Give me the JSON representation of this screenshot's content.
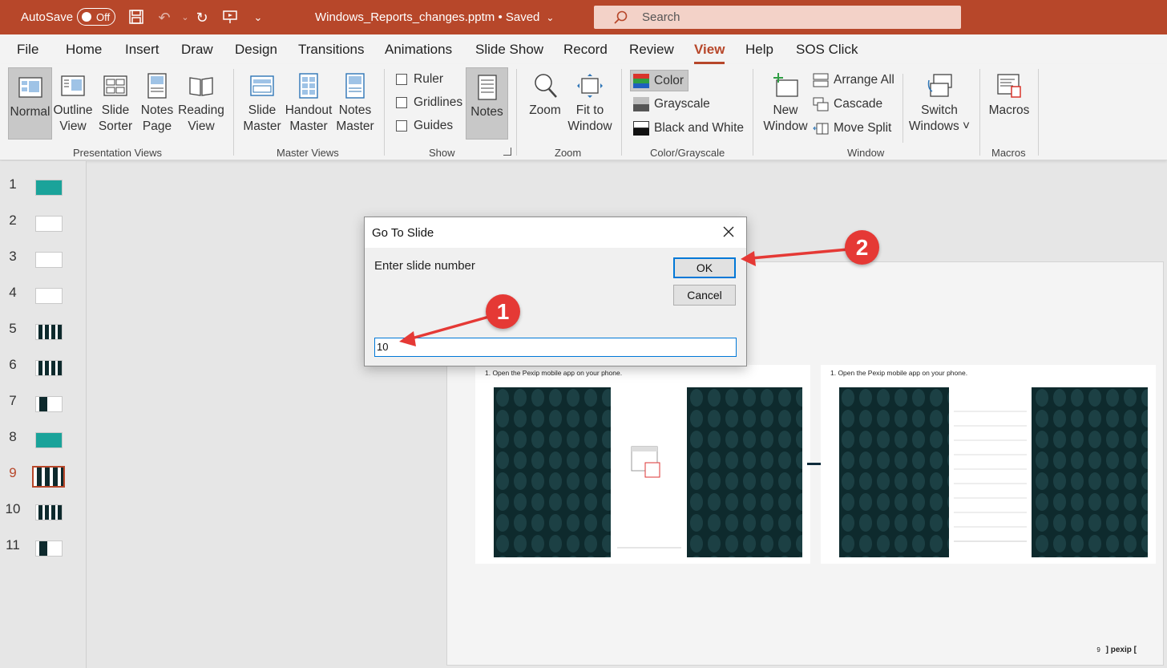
{
  "titlebar": {
    "autosave_label": "AutoSave",
    "autosave_state": "Off",
    "document_title": "Windows_Reports_changes.pptm • Saved",
    "search_placeholder": "Search",
    "accent_color": "#b7472a"
  },
  "menu": {
    "tabs": [
      "File",
      "Home",
      "Insert",
      "Draw",
      "Design",
      "Transitions",
      "Animations",
      "Slide Show",
      "Record",
      "Review",
      "View",
      "Help",
      "SOS Click"
    ],
    "active_tab": "View"
  },
  "ribbon": {
    "presentation_views": {
      "label": "Presentation Views",
      "normal": "Normal",
      "outline_1": "Outline",
      "outline_2": "View",
      "sorter_1": "Slide",
      "sorter_2": "Sorter",
      "notespage_1": "Notes",
      "notespage_2": "Page",
      "reading_1": "Reading",
      "reading_2": "View"
    },
    "master_views": {
      "label": "Master Views",
      "slide_1": "Slide",
      "slide_2": "Master",
      "handout_1": "Handout",
      "handout_2": "Master",
      "notes_1": "Notes",
      "notes_2": "Master"
    },
    "show": {
      "label": "Show",
      "ruler": "Ruler",
      "gridlines": "Gridlines",
      "guides": "Guides",
      "notes": "Notes"
    },
    "zoom": {
      "label": "Zoom",
      "zoom": "Zoom",
      "fit_1": "Fit to",
      "fit_2": "Window"
    },
    "color": {
      "label": "Color/Grayscale",
      "color": "Color",
      "grayscale": "Grayscale",
      "bw": "Black and White"
    },
    "window": {
      "label": "Window",
      "new_1": "New",
      "new_2": "Window",
      "arrange": "Arrange All",
      "cascade": "Cascade",
      "move_split": "Move Split",
      "switch_1": "Switch",
      "switch_2": "Windows ˅"
    },
    "macros": {
      "label": "Macros",
      "macros": "Macros"
    }
  },
  "thumbnails": {
    "numbers": [
      "1",
      "2",
      "3",
      "4",
      "5",
      "6",
      "7",
      "8",
      "9",
      "10",
      "11"
    ],
    "current": "9"
  },
  "slide": {
    "caption_left": "1.   Open the Pexip mobile app on your phone.",
    "caption_right": "1.   Open the Pexip mobile app on your phone.",
    "footer_number": "9",
    "footer_brand": "] pexip ["
  },
  "dialog": {
    "title": "Go To Slide",
    "prompt": "Enter slide number",
    "ok": "OK",
    "cancel": "Cancel",
    "input_value": "10"
  },
  "annotations": {
    "badge_1": "1",
    "badge_2": "2",
    "color": "#e53935"
  }
}
